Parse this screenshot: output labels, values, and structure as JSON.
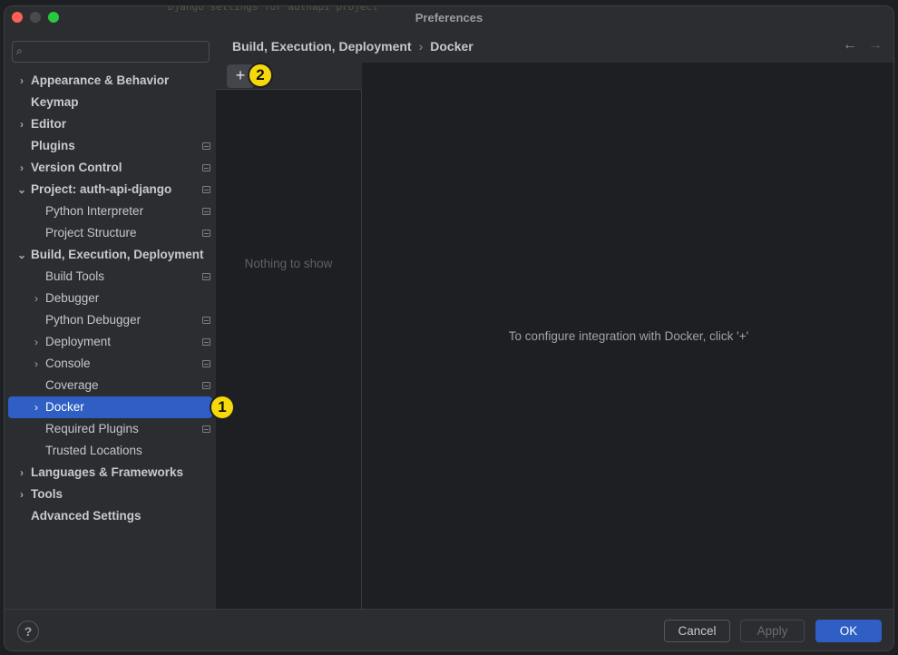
{
  "window": {
    "title": "Preferences",
    "background_code": "Django settings for authapi project"
  },
  "search": {
    "placeholder": ""
  },
  "sidebar": {
    "items": [
      {
        "label": "Appearance & Behavior",
        "level": 0,
        "expander": "collapsed",
        "bold": true,
        "badge": false
      },
      {
        "label": "Keymap",
        "level": 0,
        "expander": "none",
        "bold": true,
        "badge": false
      },
      {
        "label": "Editor",
        "level": 0,
        "expander": "collapsed",
        "bold": true,
        "badge": false
      },
      {
        "label": "Plugins",
        "level": 0,
        "expander": "none",
        "bold": true,
        "badge": true
      },
      {
        "label": "Version Control",
        "level": 0,
        "expander": "collapsed",
        "bold": true,
        "badge": true
      },
      {
        "label": "Project: auth-api-django",
        "level": 0,
        "expander": "expanded",
        "bold": true,
        "badge": true
      },
      {
        "label": "Python Interpreter",
        "level": 1,
        "expander": "none",
        "bold": false,
        "badge": true
      },
      {
        "label": "Project Structure",
        "level": 1,
        "expander": "none",
        "bold": false,
        "badge": true
      },
      {
        "label": "Build, Execution, Deployment",
        "level": 0,
        "expander": "expanded",
        "bold": true,
        "badge": false
      },
      {
        "label": "Build Tools",
        "level": 1,
        "expander": "none",
        "bold": false,
        "badge": true
      },
      {
        "label": "Debugger",
        "level": 1,
        "expander": "collapsed",
        "bold": false,
        "badge": false
      },
      {
        "label": "Python Debugger",
        "level": 1,
        "expander": "none",
        "bold": false,
        "badge": true
      },
      {
        "label": "Deployment",
        "level": 1,
        "expander": "collapsed",
        "bold": false,
        "badge": true
      },
      {
        "label": "Console",
        "level": 1,
        "expander": "collapsed",
        "bold": false,
        "badge": true
      },
      {
        "label": "Coverage",
        "level": 1,
        "expander": "none",
        "bold": false,
        "badge": true
      },
      {
        "label": "Docker",
        "level": 1,
        "expander": "collapsed",
        "bold": false,
        "badge": false,
        "selected": true
      },
      {
        "label": "Required Plugins",
        "level": 1,
        "expander": "none",
        "bold": false,
        "badge": true
      },
      {
        "label": "Trusted Locations",
        "level": 1,
        "expander": "none",
        "bold": false,
        "badge": false
      },
      {
        "label": "Languages & Frameworks",
        "level": 0,
        "expander": "collapsed",
        "bold": true,
        "badge": false
      },
      {
        "label": "Tools",
        "level": 0,
        "expander": "collapsed",
        "bold": true,
        "badge": false
      },
      {
        "label": "Advanced Settings",
        "level": 0,
        "expander": "none",
        "bold": true,
        "badge": false
      }
    ]
  },
  "breadcrumb": {
    "parent": "Build, Execution, Deployment",
    "separator": "›",
    "current": "Docker"
  },
  "nav": {
    "back": "←",
    "forward": "→"
  },
  "toolbar": {
    "add_label": "+"
  },
  "list": {
    "empty_text": "Nothing to show"
  },
  "main": {
    "hint": "To configure integration with Docker, click '+'"
  },
  "markers": {
    "first": "1",
    "second": "2"
  },
  "footer": {
    "help": "?",
    "cancel": "Cancel",
    "apply": "Apply",
    "ok": "OK"
  },
  "colors": {
    "accent": "#2f5fc4",
    "marker": "#f5d90a",
    "background": "#1e1f22",
    "panel": "#2b2d30"
  }
}
